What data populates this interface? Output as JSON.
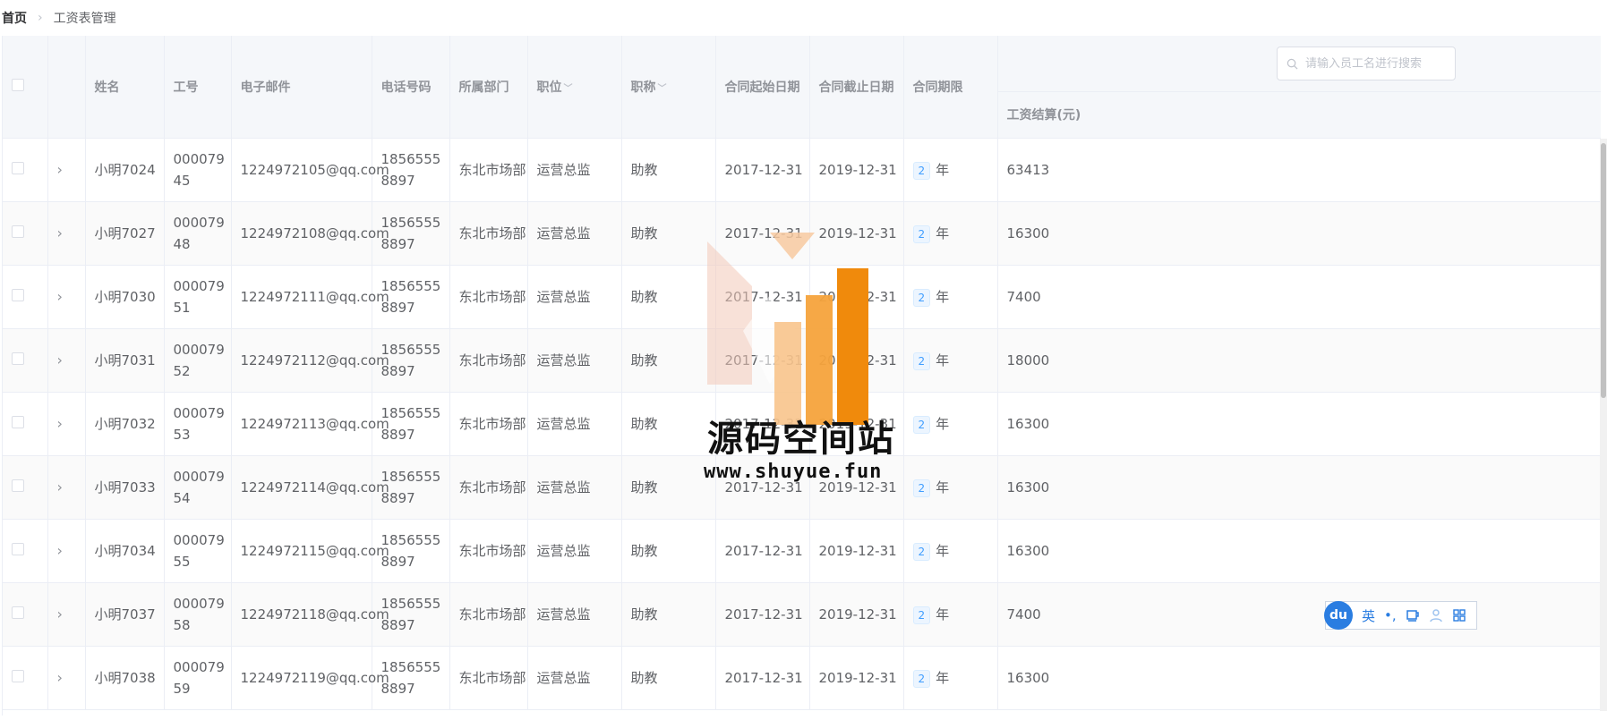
{
  "breadcrumb": {
    "home": "首页",
    "separator": "›",
    "current": "工资表管理"
  },
  "search": {
    "placeholder": "请输入员工名进行搜索"
  },
  "table": {
    "headers": {
      "name": "姓名",
      "emp_no": "工号",
      "email": "电子邮件",
      "phone": "电话号码",
      "dept": "所属部门",
      "position": "职位",
      "title": "职称",
      "contract_start": "合同起始日期",
      "contract_end": "合同截止日期",
      "contract_term": "合同期限",
      "salary": "工资结算(元)"
    },
    "term_unit": "年",
    "rows": [
      {
        "name": "小明7024",
        "emp_no": "00007945",
        "email": "1224972105@qq.com",
        "phone": "18565558897",
        "dept": "东北市场部",
        "position": "运营总监",
        "title": "助教",
        "start": "2017-12-31",
        "end": "2019-12-31",
        "term": "2",
        "salary": "63413"
      },
      {
        "name": "小明7027",
        "emp_no": "00007948",
        "email": "1224972108@qq.com",
        "phone": "18565558897",
        "dept": "东北市场部",
        "position": "运营总监",
        "title": "助教",
        "start": "2017-12-31",
        "end": "2019-12-31",
        "term": "2",
        "salary": "16300"
      },
      {
        "name": "小明7030",
        "emp_no": "00007951",
        "email": "1224972111@qq.com",
        "phone": "18565558897",
        "dept": "东北市场部",
        "position": "运营总监",
        "title": "助教",
        "start": "2017-12-31",
        "end": "2019-12-31",
        "term": "2",
        "salary": "7400"
      },
      {
        "name": "小明7031",
        "emp_no": "00007952",
        "email": "1224972112@qq.com",
        "phone": "18565558897",
        "dept": "东北市场部",
        "position": "运营总监",
        "title": "助教",
        "start": "2017-12-31",
        "end": "2019-12-31",
        "term": "2",
        "salary": "18000"
      },
      {
        "name": "小明7032",
        "emp_no": "00007953",
        "email": "1224972113@qq.com",
        "phone": "18565558897",
        "dept": "东北市场部",
        "position": "运营总监",
        "title": "助教",
        "start": "2017-12-31",
        "end": "2019-12-31",
        "term": "2",
        "salary": "16300"
      },
      {
        "name": "小明7033",
        "emp_no": "00007954",
        "email": "1224972114@qq.com",
        "phone": "18565558897",
        "dept": "东北市场部",
        "position": "运营总监",
        "title": "助教",
        "start": "2017-12-31",
        "end": "2019-12-31",
        "term": "2",
        "salary": "16300"
      },
      {
        "name": "小明7034",
        "emp_no": "00007955",
        "email": "1224972115@qq.com",
        "phone": "18565558897",
        "dept": "东北市场部",
        "position": "运营总监",
        "title": "助教",
        "start": "2017-12-31",
        "end": "2019-12-31",
        "term": "2",
        "salary": "16300"
      },
      {
        "name": "小明7037",
        "emp_no": "00007958",
        "email": "1224972118@qq.com",
        "phone": "18565558897",
        "dept": "东北市场部",
        "position": "运营总监",
        "title": "助教",
        "start": "2017-12-31",
        "end": "2019-12-31",
        "term": "2",
        "salary": "7400"
      },
      {
        "name": "小明7038",
        "emp_no": "00007959",
        "email": "1224972119@qq.com",
        "phone": "18565558897",
        "dept": "东北市场部",
        "position": "运营总监",
        "title": "助教",
        "start": "2017-12-31",
        "end": "2019-12-31",
        "term": "2",
        "salary": "16300"
      }
    ]
  },
  "watermark": {
    "title": "源码空间站",
    "url": "www.shuyue.fun"
  },
  "ime": {
    "logo": "du",
    "mode": "英",
    "punct": "•,"
  },
  "colors": {
    "accent": "#409eff",
    "header_bg": "#f5f7fa",
    "border": "#ebeef5",
    "watermark_orange": "#f5a33c"
  }
}
